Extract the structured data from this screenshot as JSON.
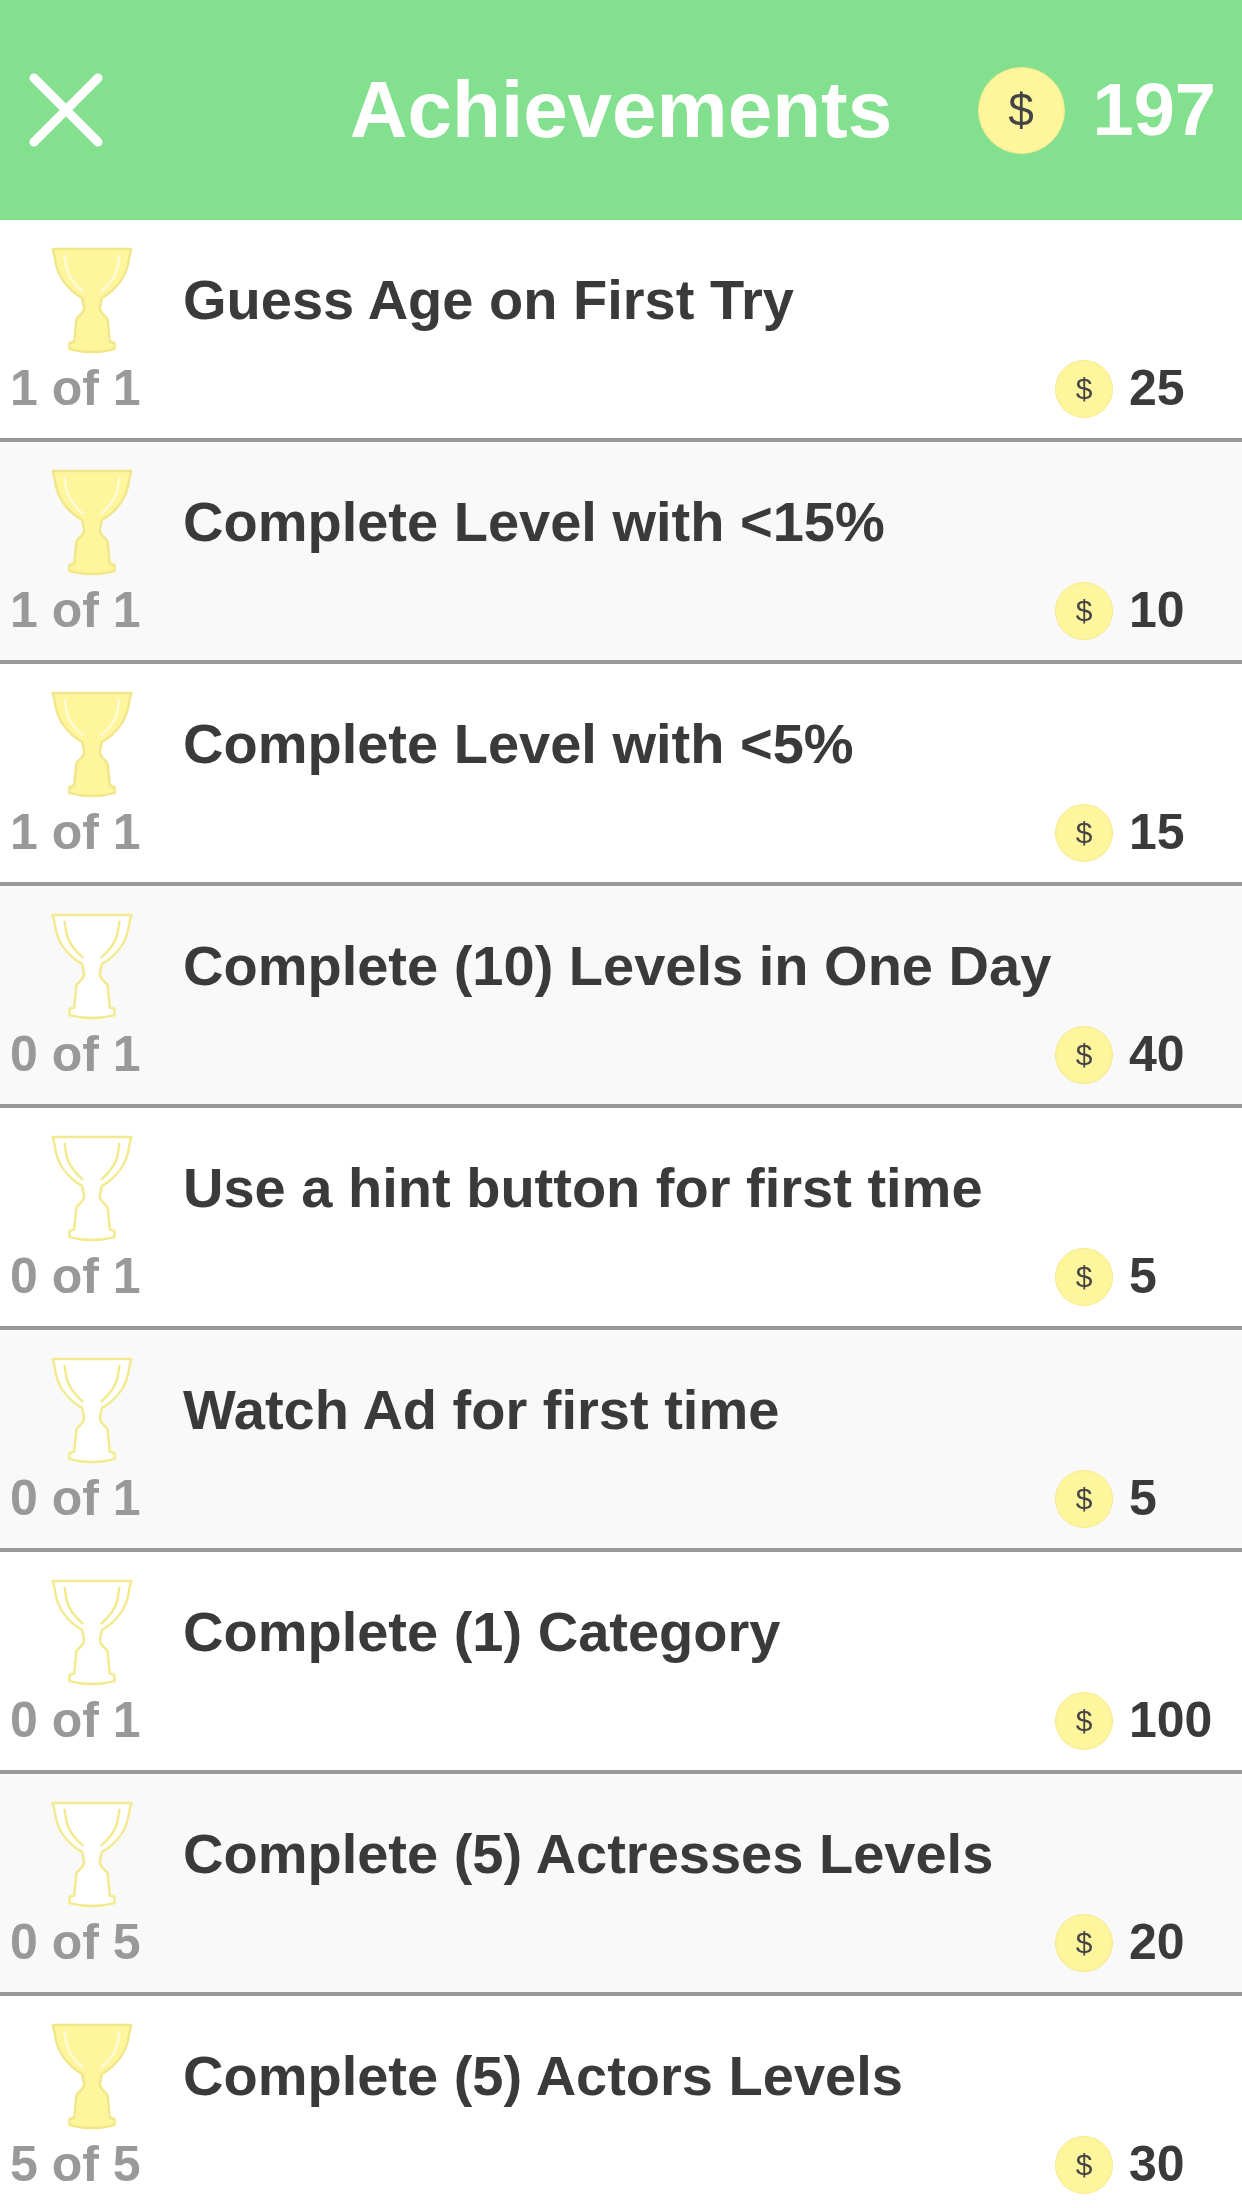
{
  "header": {
    "title": "Achievements",
    "coin_symbol": "$",
    "coins": "197"
  },
  "achievements": [
    {
      "title": "Guess Age on First Try",
      "progress": "1 of 1",
      "completed": true,
      "coin_symbol": "$",
      "reward": "25"
    },
    {
      "title": "Complete Level with <15%",
      "progress": "1 of 1",
      "completed": true,
      "coin_symbol": "$",
      "reward": "10"
    },
    {
      "title": "Complete Level with <5%",
      "progress": "1 of 1",
      "completed": true,
      "coin_symbol": "$",
      "reward": "15"
    },
    {
      "title": "Complete (10) Levels in One Day",
      "progress": "0 of 1",
      "completed": false,
      "coin_symbol": "$",
      "reward": "40"
    },
    {
      "title": "Use a hint button for first time",
      "progress": "0 of 1",
      "completed": false,
      "coin_symbol": "$",
      "reward": "5"
    },
    {
      "title": "Watch Ad for first time",
      "progress": "0 of 1",
      "completed": false,
      "coin_symbol": "$",
      "reward": "5"
    },
    {
      "title": "Complete (1) Category",
      "progress": "0 of 1",
      "completed": false,
      "coin_symbol": "$",
      "reward": "100"
    },
    {
      "title": "Complete (5) Actresses Levels",
      "progress": "0 of 5",
      "completed": false,
      "coin_symbol": "$",
      "reward": "20"
    },
    {
      "title": "Complete (5) Actors Levels",
      "progress": "5 of 5",
      "completed": true,
      "coin_symbol": "$",
      "reward": "30"
    }
  ]
}
